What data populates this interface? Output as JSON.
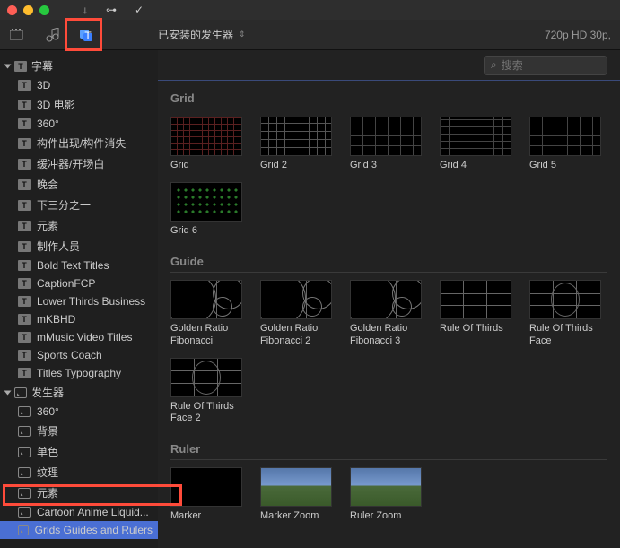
{
  "titlebar": {},
  "toolbar": {
    "dropdown_label": "已安装的发生器",
    "right_info": "720p HD 30p,"
  },
  "search": {
    "placeholder": "搜索"
  },
  "sidebar": {
    "group1": "字幕",
    "items1": [
      "3D",
      "3D 电影",
      "360°",
      "构件出现/构件消失",
      "缓冲器/开场白",
      "晚会",
      "下三分之一",
      "元素",
      "制作人员",
      "Bold Text Titles",
      "CaptionFCP",
      "Lower Thirds Business",
      "mKBHD",
      "mMusic Video Titles",
      "Sports Coach",
      "Titles Typography"
    ],
    "group2": "发生器",
    "items2": [
      "360°",
      "背景",
      "单色",
      "纹理",
      "元素",
      "Cartoon Anime Liquid...",
      "Grids Guides and Rulers"
    ]
  },
  "sections": [
    {
      "header": "Grid",
      "items": [
        {
          "label": "Grid",
          "cls": "grid-red"
        },
        {
          "label": "Grid 2",
          "cls": "grid-white"
        },
        {
          "label": "Grid 3",
          "cls": "grid-line"
        },
        {
          "label": "Grid 4",
          "cls": "grid-line-tight"
        },
        {
          "label": "Grid 5",
          "cls": "grid-line"
        },
        {
          "label": "Grid 6",
          "cls": "dots-green"
        }
      ]
    },
    {
      "header": "Guide",
      "items": [
        {
          "label": "Golden Ratio Fibonacci",
          "cls": "fib"
        },
        {
          "label": "Golden Ratio Fibonacci 2",
          "cls": "fib"
        },
        {
          "label": "Golden Ratio Fibonacci 3",
          "cls": "fib"
        },
        {
          "label": "Rule Of Thirds",
          "cls": "thirds"
        },
        {
          "label": "Rule Of Thirds Face",
          "cls": "thirds oval"
        },
        {
          "label": "Rule Of Thirds Face 2",
          "cls": "thirds oval"
        }
      ]
    },
    {
      "header": "Ruler",
      "items": [
        {
          "label": "Marker",
          "cls": "black"
        },
        {
          "label": "Marker Zoom",
          "cls": "img-thumb"
        },
        {
          "label": "Ruler Zoom",
          "cls": "img-thumb"
        }
      ]
    }
  ]
}
